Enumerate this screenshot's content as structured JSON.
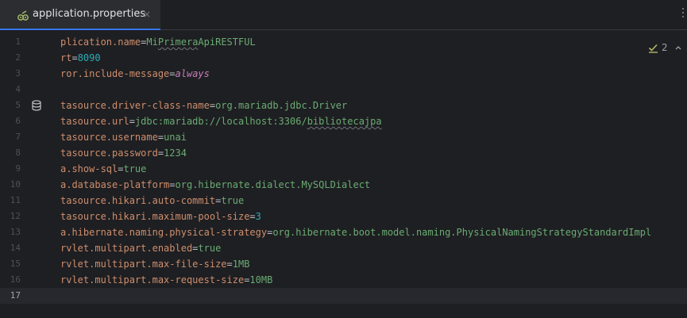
{
  "tab": {
    "title": "application.properties",
    "close_glyph": "×",
    "icon": "properties-file-icon"
  },
  "inspection": {
    "count": "2",
    "icon": "check-warning-icon",
    "toggle_icon": "chevron-up-icon"
  },
  "colors": {
    "background": "#1e1f22",
    "key": "#cf8e6d",
    "value": "#6aab73",
    "number": "#2aacb8",
    "keyword": "#c77dbb",
    "line_number": "#4b5059",
    "current_line": "#26282e",
    "tab_underline": "#3574f0"
  },
  "editor": {
    "current_line": 17,
    "lines": [
      {
        "num": "1",
        "key": "plication.name",
        "sep": "=",
        "parts": [
          {
            "text": "Mi",
            "type": "val"
          },
          {
            "text": "Primera",
            "type": "val-typo"
          },
          {
            "text": "ApiRESTFUL",
            "type": "val"
          }
        ]
      },
      {
        "num": "2",
        "key": "rt",
        "sep": "=",
        "parts": [
          {
            "text": "8090",
            "type": "num"
          }
        ]
      },
      {
        "num": "3",
        "key": "ror.include-message",
        "sep": "=",
        "parts": [
          {
            "text": "always",
            "type": "kw"
          }
        ]
      },
      {
        "num": "4",
        "key": "",
        "sep": "",
        "parts": []
      },
      {
        "num": "5",
        "key": "tasource.driver-class-name",
        "sep": "=",
        "parts": [
          {
            "text": "org.mariadb.jdbc.Driver",
            "type": "val"
          }
        ],
        "gutter_icon": "database-icon"
      },
      {
        "num": "6",
        "key": "tasource.url",
        "sep": "=",
        "parts": [
          {
            "text": "jdbc:mariadb://localhost:3306/",
            "type": "val"
          },
          {
            "text": "bibliotecajpa",
            "type": "val-typo"
          }
        ]
      },
      {
        "num": "7",
        "key": "tasource.username",
        "sep": "=",
        "parts": [
          {
            "text": "unai",
            "type": "val"
          }
        ]
      },
      {
        "num": "8",
        "key": "tasource.password",
        "sep": "=",
        "parts": [
          {
            "text": "1234",
            "type": "val"
          }
        ]
      },
      {
        "num": "9",
        "key": "a.show-sql",
        "sep": "=",
        "parts": [
          {
            "text": "true",
            "type": "val"
          }
        ]
      },
      {
        "num": "10",
        "key": "a.database-platform",
        "sep": "=",
        "parts": [
          {
            "text": "org.hibernate.dialect.MySQLDialect",
            "type": "val"
          }
        ]
      },
      {
        "num": "11",
        "key": "tasource.hikari.auto-commit",
        "sep": "=",
        "parts": [
          {
            "text": "true",
            "type": "val"
          }
        ]
      },
      {
        "num": "12",
        "key": "tasource.hikari.maximum-pool-size",
        "sep": "=",
        "parts": [
          {
            "text": "3",
            "type": "num"
          }
        ]
      },
      {
        "num": "13",
        "key": "a.hibernate.naming.physical-strategy",
        "sep": "=",
        "parts": [
          {
            "text": "org.hibernate.boot.model.naming.PhysicalNamingStrategyStandardImpl",
            "type": "val"
          }
        ]
      },
      {
        "num": "14",
        "key": "rvlet.multipart.enabled",
        "sep": "=",
        "parts": [
          {
            "text": "true",
            "type": "val"
          }
        ]
      },
      {
        "num": "15",
        "key": "rvlet.multipart.max-file-size",
        "sep": "=",
        "parts": [
          {
            "text": "1MB",
            "type": "val"
          }
        ]
      },
      {
        "num": "16",
        "key": "rvlet.multipart.max-request-size",
        "sep": "=",
        "parts": [
          {
            "text": "10MB",
            "type": "val"
          }
        ]
      },
      {
        "num": "17",
        "key": "",
        "sep": "",
        "parts": []
      }
    ]
  }
}
